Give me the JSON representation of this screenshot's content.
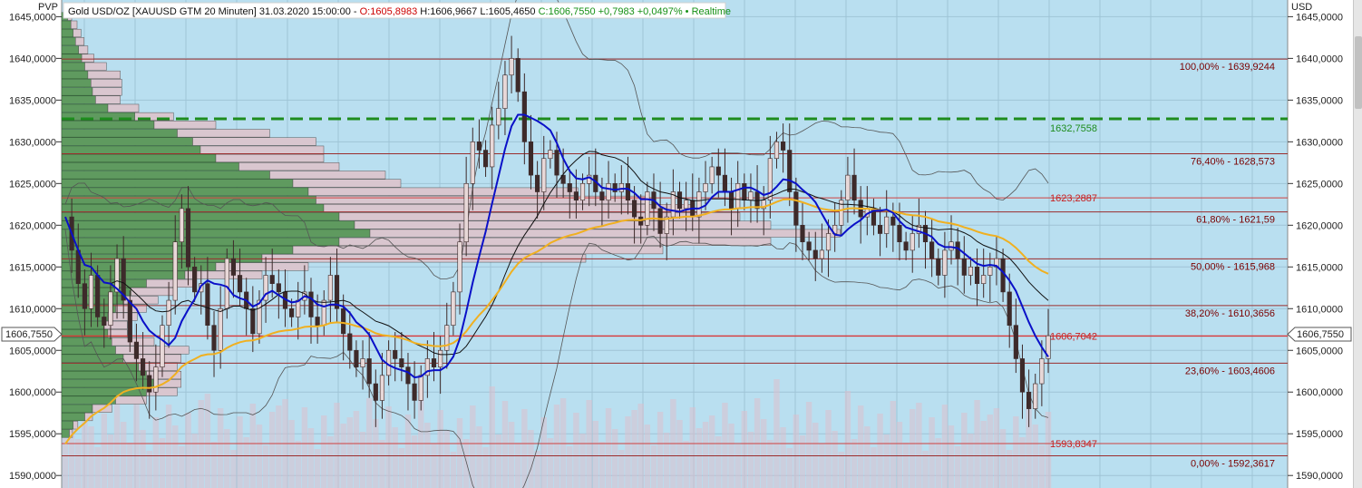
{
  "header": {
    "pvp_label": "PVP",
    "symbol": "Gold USD/OZ [XAUUSD GTM 20 Minuten] 31.03.2020 15:00:00 - ",
    "open": "O:1605,8983",
    "high_low": " H:1606,9667 L:1605,4650 ",
    "close_change": "C:1606,7550 +0,7983 +0,0497%",
    "realtime": " • Realtime",
    "currency": "USD"
  },
  "colors": {
    "plot_bg": "#b9dff0",
    "profile_buy": "#5f9a5f",
    "profile_sell": "#d9c6cf",
    "fib_line": "#9b2d2d",
    "poc_line": "#1e8c1e",
    "ma_fast": "#0a10c8",
    "ma_slow": "#f0b020",
    "bollinger": "#555555",
    "candle": "#3d2a2a"
  },
  "chart_data": {
    "type": "candlestick",
    "ylim": [
      1588.5,
      1647
    ],
    "y_ticks": [
      1590,
      1595,
      1600,
      1605,
      1610,
      1615,
      1620,
      1625,
      1630,
      1635,
      1640,
      1645
    ],
    "y_tick_labels": [
      "1590,0000",
      "1595,0000",
      "1600,0000",
      "1605,0000",
      "1610,0000",
      "1615,0000",
      "1620,0000",
      "1625,0000",
      "1630,0000",
      "1635,0000",
      "1640,0000",
      "1645,0000"
    ],
    "current_price": 1606.755,
    "current_price_label": "1606,7550",
    "fib_levels": [
      {
        "value": 1639.9244,
        "label": "100,00% - 1639,9244"
      },
      {
        "value": 1628.573,
        "label": "76,40% - 1628,573"
      },
      {
        "value": 1621.59,
        "label": "61,80% - 1621,59"
      },
      {
        "value": 1615.968,
        "label": "50,00% - 1615,968"
      },
      {
        "value": 1610.3656,
        "label": "38,20% - 1610,3656"
      },
      {
        "value": 1603.4606,
        "label": "23,60% - 1603,4606"
      },
      {
        "value": 1592.3617,
        "label": "0,00% - 1592,3617"
      }
    ],
    "extra_levels": [
      {
        "value": 1623.2887,
        "label": "1623,2887"
      },
      {
        "value": 1606.7042,
        "label": "1606,7042"
      },
      {
        "value": 1593.8347,
        "label": "1593,8347"
      }
    ],
    "poc": {
      "value": 1632.7558,
      "label": "1632,7558"
    },
    "close_series": [
      1621,
      1617,
      1613,
      1610,
      1614,
      1609,
      1608,
      1612,
      1616,
      1611,
      1606,
      1604,
      1602,
      1600,
      1603,
      1608,
      1611,
      1618,
      1622,
      1615,
      1612,
      1613,
      1608,
      1605,
      1610,
      1616,
      1614,
      1612,
      1610,
      1607,
      1611,
      1614,
      1613,
      1612,
      1610,
      1609,
      1611,
      1612,
      1609,
      1608,
      1611,
      1614,
      1610,
      1607,
      1605,
      1603,
      1604,
      1601,
      1599,
      1602,
      1605,
      1604,
      1603,
      1601,
      1599,
      1602,
      1604,
      1603,
      1605,
      1608,
      1612,
      1618,
      1625,
      1630,
      1629,
      1627,
      1632,
      1634,
      1638,
      1640,
      1636,
      1630,
      1626,
      1624,
      1628,
      1629,
      1626,
      1625,
      1624,
      1623,
      1625,
      1626,
      1624,
      1623,
      1625,
      1624,
      1625,
      1623,
      1621,
      1620,
      1624,
      1622,
      1619,
      1621,
      1624,
      1622,
      1623,
      1621,
      1624,
      1625,
      1627,
      1626,
      1624,
      1622,
      1625,
      1623,
      1624,
      1622,
      1623,
      1628,
      1630,
      1629,
      1624,
      1620,
      1618,
      1617,
      1616,
      1617,
      1619,
      1620,
      1623,
      1626,
      1623,
      1621,
      1622,
      1620,
      1619,
      1621,
      1620,
      1618,
      1617,
      1619,
      1620,
      1618,
      1616,
      1614,
      1617,
      1618,
      1616,
      1614,
      1615,
      1613,
      1614,
      1615,
      1616,
      1612,
      1608,
      1604,
      1600,
      1598,
      1601,
      1604,
      1606.755
    ],
    "profile": [
      {
        "price": 1645,
        "buy": 8,
        "sell": 5
      },
      {
        "price": 1644,
        "buy": 12,
        "sell": 8
      },
      {
        "price": 1643,
        "buy": 15,
        "sell": 10
      },
      {
        "price": 1642,
        "buy": 18,
        "sell": 11
      },
      {
        "price": 1641,
        "buy": 22,
        "sell": 12
      },
      {
        "price": 1640,
        "buy": 26,
        "sell": 16
      },
      {
        "price": 1639,
        "buy": 30,
        "sell": 28
      },
      {
        "price": 1638,
        "buy": 34,
        "sell": 42
      },
      {
        "price": 1637,
        "buy": 38,
        "sell": 40
      },
      {
        "price": 1636,
        "buy": 40,
        "sell": 38
      },
      {
        "price": 1635,
        "buy": 44,
        "sell": 32
      },
      {
        "price": 1634,
        "buy": 60,
        "sell": 40
      },
      {
        "price": 1633,
        "buy": 95,
        "sell": 50
      },
      {
        "price": 1632,
        "buy": 120,
        "sell": 80
      },
      {
        "price": 1631,
        "buy": 150,
        "sell": 120
      },
      {
        "price": 1630,
        "buy": 170,
        "sell": 160
      },
      {
        "price": 1629,
        "buy": 180,
        "sell": 160
      },
      {
        "price": 1628,
        "buy": 200,
        "sell": 140
      },
      {
        "price": 1627,
        "buy": 230,
        "sell": 130
      },
      {
        "price": 1626,
        "buy": 270,
        "sell": 150
      },
      {
        "price": 1625,
        "buy": 300,
        "sell": 140
      },
      {
        "price": 1624,
        "buy": 320,
        "sell": 350
      },
      {
        "price": 1623,
        "buy": 330,
        "sell": 430
      },
      {
        "price": 1622,
        "buy": 340,
        "sell": 480
      },
      {
        "price": 1621,
        "buy": 360,
        "sell": 520
      },
      {
        "price": 1620,
        "buy": 380,
        "sell": 540
      },
      {
        "price": 1619,
        "buy": 400,
        "sell": 610
      },
      {
        "price": 1618,
        "buy": 360,
        "sell": 560
      },
      {
        "price": 1617,
        "buy": 300,
        "sell": 480
      },
      {
        "price": 1616,
        "buy": 260,
        "sell": 420
      },
      {
        "price": 1615,
        "buy": 200,
        "sell": 120
      },
      {
        "price": 1614,
        "buy": 160,
        "sell": 100
      },
      {
        "price": 1613,
        "buy": 110,
        "sell": 60
      },
      {
        "price": 1612,
        "buy": 90,
        "sell": 55
      },
      {
        "price": 1611,
        "buy": 80,
        "sell": 45
      },
      {
        "price": 1610,
        "buy": 70,
        "sell": 40
      },
      {
        "price": 1609,
        "buy": 60,
        "sell": 38
      },
      {
        "price": 1608,
        "buy": 55,
        "sell": 30
      },
      {
        "price": 1607,
        "buy": 60,
        "sell": 25
      },
      {
        "price": 1606,
        "buy": 65,
        "sell": 55
      },
      {
        "price": 1605,
        "buy": 70,
        "sell": 95
      },
      {
        "price": 1604,
        "buy": 80,
        "sell": 75
      },
      {
        "price": 1603,
        "buy": 100,
        "sell": 50
      },
      {
        "price": 1602,
        "buy": 110,
        "sell": 45
      },
      {
        "price": 1601,
        "buy": 125,
        "sell": 30
      },
      {
        "price": 1600,
        "buy": 110,
        "sell": 40
      },
      {
        "price": 1599,
        "buy": 70,
        "sell": 40
      },
      {
        "price": 1598,
        "buy": 40,
        "sell": 25
      },
      {
        "price": 1597,
        "buy": 30,
        "sell": 10
      },
      {
        "price": 1596,
        "buy": 15,
        "sell": 6
      },
      {
        "price": 1595,
        "buy": 10,
        "sell": 4
      }
    ]
  }
}
